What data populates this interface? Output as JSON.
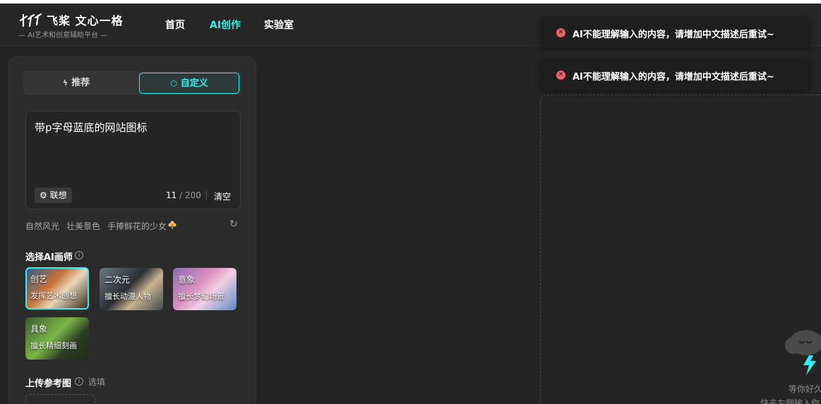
{
  "brand": {
    "title": "飞桨 文心一格",
    "subtitle": "AI艺术和创意辅助平台"
  },
  "nav": {
    "items": [
      "首页",
      "AI创作",
      "实验室"
    ],
    "active": "AI创作"
  },
  "toasts": [
    {
      "text": "AI不能理解输入的内容，请增加中文描述后重试~"
    },
    {
      "text": "AI不能理解输入的内容，请增加中文描述后重试~"
    }
  ],
  "mode_tabs": {
    "recommend": "推荐",
    "custom": "自定义"
  },
  "prompt": {
    "value": "带p字母蓝底的网站图标",
    "associate_label": "联想",
    "count": "11",
    "max": "200",
    "clear_label": "清空"
  },
  "suggestions": [
    "自然风光",
    "壮美景色",
    "手捧鲜花的少女"
  ],
  "painter": {
    "title": "选择AI画师",
    "cards": [
      {
        "name": "创艺",
        "desc": "发挥艺术创想",
        "selected": true
      },
      {
        "name": "二次元",
        "desc": "擅长动漫人物",
        "selected": false
      },
      {
        "name": "意象",
        "desc": "擅长梦幻场景",
        "selected": false
      },
      {
        "name": "具象",
        "desc": "擅长精细刻画",
        "selected": false
      }
    ]
  },
  "upload": {
    "title": "上传参考图",
    "optional": "选填"
  },
  "empty_state": {
    "line1": "等你好久",
    "line2": "快去左侧输入你"
  },
  "colors": {
    "accent": "#2ef2ef",
    "error": "#f25c6b",
    "background": "#242424",
    "panel": "#2b2b2b"
  }
}
